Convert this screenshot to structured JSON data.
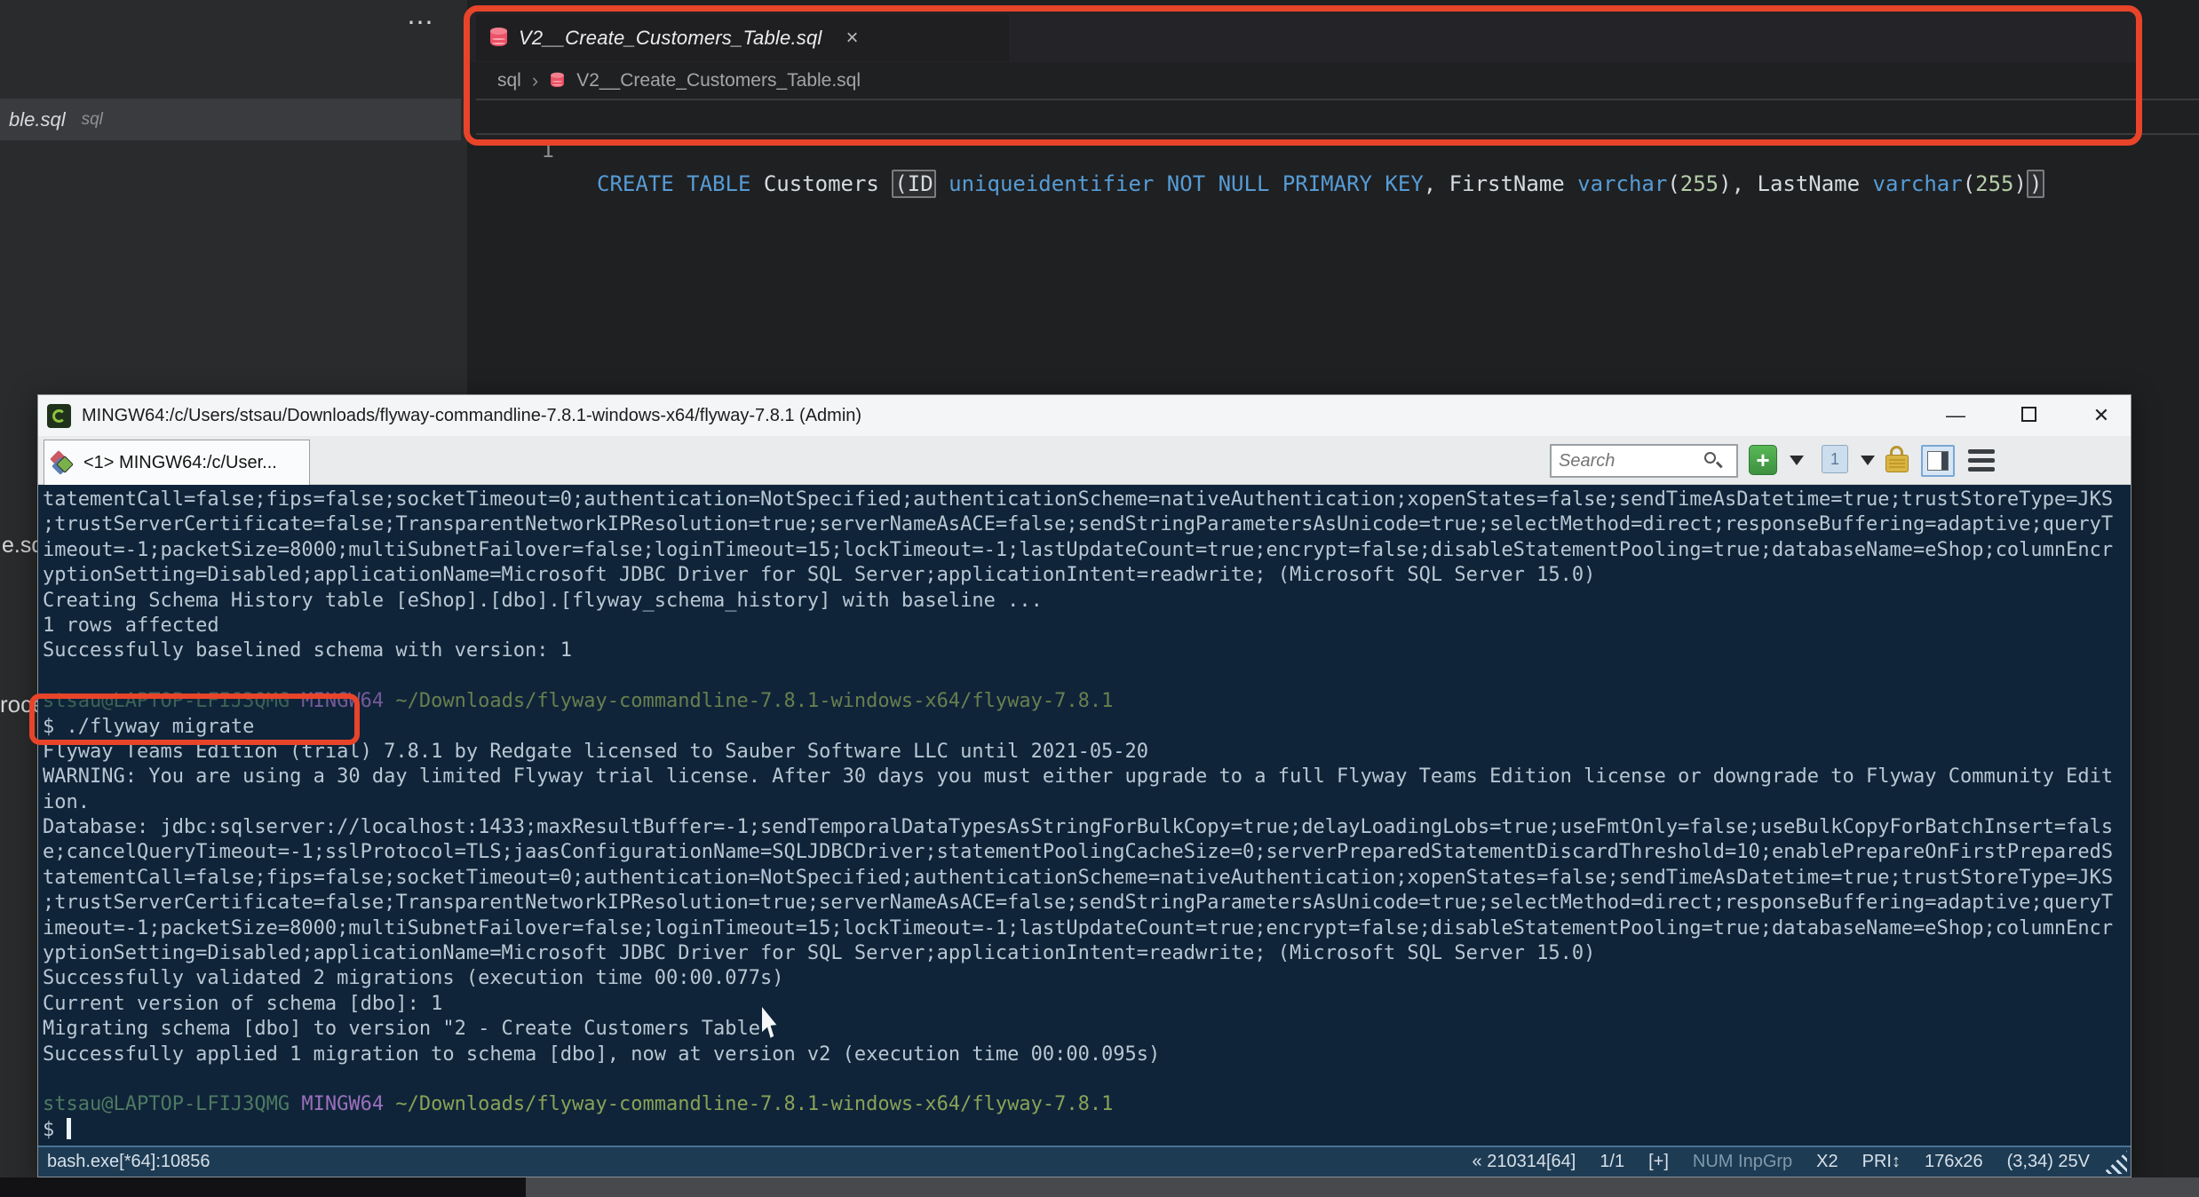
{
  "colors": {
    "annotation_red": "#e8442a",
    "console_bg": "#0f2439",
    "console_text": "#b9c7d3",
    "prompt_user_green": "#4e7a62",
    "prompt_mingw_purple": "#9c70bd",
    "prompt_path_olive": "#89a257",
    "sql_keyword_blue": "#569cd6",
    "statusbar_bg": "#1e3b54"
  },
  "background": {
    "ellipsis": "⋯",
    "partial_tab": {
      "filename": "ble.sql",
      "language": "sql"
    },
    "fragments": {
      "f1": "e.sq",
      "f2": "roce"
    }
  },
  "editor": {
    "tab": {
      "filename": "V2__Create_Customers_Table.sql",
      "close": "×"
    },
    "breadcrumb": {
      "folder": "sql",
      "separator": "›",
      "file": "V2__Create_Customers_Table.sql"
    },
    "code": {
      "line_number": "1",
      "tokens": [
        {
          "t": "CREATE TABLE",
          "c": "kw"
        },
        {
          "t": " Customers ",
          "c": "pl"
        },
        {
          "t": "(ID",
          "c": "pl boxed"
        },
        {
          "t": " ",
          "c": "pl"
        },
        {
          "t": "uniqueidentifier NOT NULL PRIMARY KEY",
          "c": "kw"
        },
        {
          "t": ", FirstName ",
          "c": "pl"
        },
        {
          "t": "varchar",
          "c": "kw"
        },
        {
          "t": "(",
          "c": "pl"
        },
        {
          "t": "255",
          "c": "num"
        },
        {
          "t": "), LastName ",
          "c": "pl"
        },
        {
          "t": "varchar",
          "c": "kw"
        },
        {
          "t": "(",
          "c": "pl"
        },
        {
          "t": "255",
          "c": "num"
        },
        {
          "t": ")",
          "c": "pl"
        },
        {
          "t": ")",
          "c": "pl boxed"
        }
      ]
    }
  },
  "terminal": {
    "title": "MINGW64:/c/Users/stsau/Downloads/flyway-commandline-7.8.1-windows-x64/flyway-7.8.1 (Admin)",
    "controls": {
      "minimize": "—",
      "close": "✕"
    },
    "tab_label": "<1> MINGW64:/c/User...",
    "search": {
      "placeholder": "Search"
    },
    "toolbar": {
      "new_console": "+",
      "console_number": "1"
    },
    "console": {
      "lines": [
        {
          "seg": [
            [
              "tatementCall=false;fips=false;socketTimeout=0;authentication=NotSpecified;authenticationScheme=nativeAuthentication;xopenStates=false;sendTimeAsDatetime=true;trustStoreType=JKS",
              "t"
            ]
          ]
        },
        {
          "seg": [
            [
              ";trustServerCertificate=false;TransparentNetworkIPResolution=true;serverNameAsACE=false;sendStringParametersAsUnicode=true;selectMethod=direct;responseBuffering=adaptive;queryT",
              "t"
            ]
          ]
        },
        {
          "seg": [
            [
              "imeout=-1;packetSize=8000;multiSubnetFailover=false;loginTimeout=15;lockTimeout=-1;lastUpdateCount=true;encrypt=false;disableStatementPooling=true;databaseName=eShop;columnEncr",
              "t"
            ]
          ]
        },
        {
          "seg": [
            [
              "yptionSetting=Disabled;applicationName=Microsoft JDBC Driver for SQL Server;applicationIntent=readwrite; (Microsoft SQL Server 15.0)",
              "t"
            ]
          ]
        },
        {
          "seg": [
            [
              "Creating Schema History table [eShop].[dbo].[flyway_schema_history] with baseline ...",
              "t"
            ]
          ]
        },
        {
          "seg": [
            [
              "1 rows affected",
              "t"
            ]
          ]
        },
        {
          "seg": [
            [
              "Successfully baselined schema with version: 1",
              "t"
            ]
          ]
        },
        {
          "seg": []
        },
        {
          "dim": true,
          "seg": [
            [
              "stsau@LAPTOP-LFIJ3QMG ",
              "u"
            ],
            [
              "MINGW64 ",
              "m"
            ],
            [
              "~/Downloads/flyway-commandline-7.8.1-windows-x64/flyway-7.8.1",
              "p"
            ]
          ]
        },
        {
          "seg": [
            [
              "$ ./flyway migrate",
              "t"
            ]
          ]
        },
        {
          "seg": [
            [
              "Flyway Teams Edition (trial) 7.8.1 by Redgate licensed to Sauber Software LLC until 2021-05-20",
              "t"
            ]
          ]
        },
        {
          "seg": [
            [
              "WARNING: You are using a 30 day limited Flyway trial license. After 30 days you must either upgrade to a full Flyway Teams Edition license or downgrade to Flyway Community Edit",
              "t"
            ]
          ]
        },
        {
          "seg": [
            [
              "ion.",
              "t"
            ]
          ]
        },
        {
          "seg": [
            [
              "Database: jdbc:sqlserver://localhost:1433;maxResultBuffer=-1;sendTemporalDataTypesAsStringForBulkCopy=true;delayLoadingLobs=true;useFmtOnly=false;useBulkCopyForBatchInsert=fals",
              "t"
            ]
          ]
        },
        {
          "seg": [
            [
              "e;cancelQueryTimeout=-1;sslProtocol=TLS;jaasConfigurationName=SQLJDBCDriver;statementPoolingCacheSize=0;serverPreparedStatementDiscardThreshold=10;enablePrepareOnFirstPreparedS",
              "t"
            ]
          ]
        },
        {
          "seg": [
            [
              "tatementCall=false;fips=false;socketTimeout=0;authentication=NotSpecified;authenticationScheme=nativeAuthentication;xopenStates=false;sendTimeAsDatetime=true;trustStoreType=JKS",
              "t"
            ]
          ]
        },
        {
          "seg": [
            [
              ";trustServerCertificate=false;TransparentNetworkIPResolution=true;serverNameAsACE=false;sendStringParametersAsUnicode=true;selectMethod=direct;responseBuffering=adaptive;queryT",
              "t"
            ]
          ]
        },
        {
          "seg": [
            [
              "imeout=-1;packetSize=8000;multiSubnetFailover=false;loginTimeout=15;lockTimeout=-1;lastUpdateCount=true;encrypt=false;disableStatementPooling=true;databaseName=eShop;columnEncr",
              "t"
            ]
          ]
        },
        {
          "seg": [
            [
              "yptionSetting=Disabled;applicationName=Microsoft JDBC Driver for SQL Server;applicationIntent=readwrite; (Microsoft SQL Server 15.0)",
              "t"
            ]
          ]
        },
        {
          "seg": [
            [
              "Successfully validated 2 migrations (execution time 00:00.077s)",
              "t"
            ]
          ]
        },
        {
          "seg": [
            [
              "Current version of schema [dbo]: 1",
              "t"
            ]
          ]
        },
        {
          "seg": [
            [
              "Migrating schema [dbo] to version \"2 - Create Customers Table\"",
              "t"
            ]
          ]
        },
        {
          "seg": [
            [
              "Successfully applied 1 migration to schema [dbo], now at version v2 (execution time 00:00.095s)",
              "t"
            ]
          ]
        },
        {
          "seg": []
        },
        {
          "seg": [
            [
              "stsau@LAPTOP-LFIJ3QMG ",
              "u"
            ],
            [
              "MINGW64 ",
              "m"
            ],
            [
              "~/Downloads/flyway-commandline-7.8.1-windows-x64/flyway-7.8.1",
              "p"
            ]
          ]
        },
        {
          "seg": [
            [
              "$ ",
              "t"
            ],
            [
              "",
              "cursor"
            ]
          ]
        }
      ]
    },
    "status": {
      "left": "bash.exe[*64]:10856",
      "items": [
        {
          "t": "« 210314[64]",
          "dim": false
        },
        {
          "t": "1/1",
          "dim": false
        },
        {
          "t": "[+]",
          "dim": false
        },
        {
          "t": "NUM InpGrp",
          "dim": true
        },
        {
          "t": "X2",
          "dim": false
        },
        {
          "t": "PRI↕",
          "dim": false
        },
        {
          "t": "176x26",
          "dim": false
        },
        {
          "t": "(3,34) 25V",
          "dim": false
        }
      ]
    }
  }
}
